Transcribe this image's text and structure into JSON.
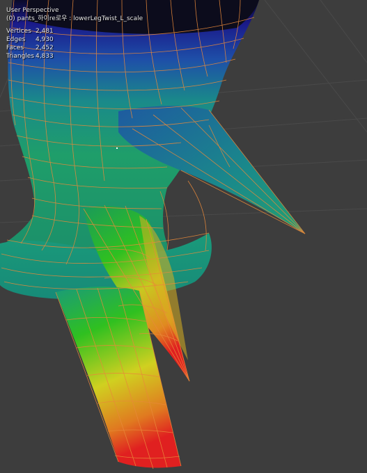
{
  "viewport": {
    "view_name": "User Perspective",
    "object_line": "(0) pants_하이re로우 : lowerLegTwist_L_scale"
  },
  "stats": [
    {
      "label": "Vertices",
      "value": "2,481"
    },
    {
      "label": "Edges",
      "value": "4,930"
    },
    {
      "label": "Faces",
      "value": "2,452"
    },
    {
      "label": "Triangles",
      "value": "4,833"
    }
  ],
  "colors": {
    "background": "#3d3d3d",
    "grid": "#4a4a4a",
    "wire": "#e8893a",
    "weight_low": "#1a1a8a",
    "weight_mid": "#1fae3a",
    "weight_high": "#e02020"
  }
}
